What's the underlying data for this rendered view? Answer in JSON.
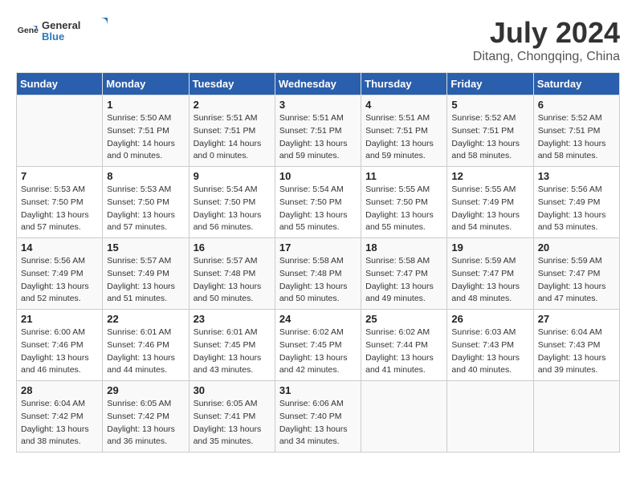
{
  "logo": {
    "general": "General",
    "blue": "Blue"
  },
  "title": "July 2024",
  "subtitle": "Ditang, Chongqing, China",
  "weekdays": [
    "Sunday",
    "Monday",
    "Tuesday",
    "Wednesday",
    "Thursday",
    "Friday",
    "Saturday"
  ],
  "weeks": [
    [
      {
        "day": "",
        "info": ""
      },
      {
        "day": "1",
        "info": "Sunrise: 5:50 AM\nSunset: 7:51 PM\nDaylight: 14 hours\nand 0 minutes."
      },
      {
        "day": "2",
        "info": "Sunrise: 5:51 AM\nSunset: 7:51 PM\nDaylight: 14 hours\nand 0 minutes."
      },
      {
        "day": "3",
        "info": "Sunrise: 5:51 AM\nSunset: 7:51 PM\nDaylight: 13 hours\nand 59 minutes."
      },
      {
        "day": "4",
        "info": "Sunrise: 5:51 AM\nSunset: 7:51 PM\nDaylight: 13 hours\nand 59 minutes."
      },
      {
        "day": "5",
        "info": "Sunrise: 5:52 AM\nSunset: 7:51 PM\nDaylight: 13 hours\nand 58 minutes."
      },
      {
        "day": "6",
        "info": "Sunrise: 5:52 AM\nSunset: 7:51 PM\nDaylight: 13 hours\nand 58 minutes."
      }
    ],
    [
      {
        "day": "7",
        "info": "Sunrise: 5:53 AM\nSunset: 7:50 PM\nDaylight: 13 hours\nand 57 minutes."
      },
      {
        "day": "8",
        "info": "Sunrise: 5:53 AM\nSunset: 7:50 PM\nDaylight: 13 hours\nand 57 minutes."
      },
      {
        "day": "9",
        "info": "Sunrise: 5:54 AM\nSunset: 7:50 PM\nDaylight: 13 hours\nand 56 minutes."
      },
      {
        "day": "10",
        "info": "Sunrise: 5:54 AM\nSunset: 7:50 PM\nDaylight: 13 hours\nand 55 minutes."
      },
      {
        "day": "11",
        "info": "Sunrise: 5:55 AM\nSunset: 7:50 PM\nDaylight: 13 hours\nand 55 minutes."
      },
      {
        "day": "12",
        "info": "Sunrise: 5:55 AM\nSunset: 7:49 PM\nDaylight: 13 hours\nand 54 minutes."
      },
      {
        "day": "13",
        "info": "Sunrise: 5:56 AM\nSunset: 7:49 PM\nDaylight: 13 hours\nand 53 minutes."
      }
    ],
    [
      {
        "day": "14",
        "info": "Sunrise: 5:56 AM\nSunset: 7:49 PM\nDaylight: 13 hours\nand 52 minutes."
      },
      {
        "day": "15",
        "info": "Sunrise: 5:57 AM\nSunset: 7:49 PM\nDaylight: 13 hours\nand 51 minutes."
      },
      {
        "day": "16",
        "info": "Sunrise: 5:57 AM\nSunset: 7:48 PM\nDaylight: 13 hours\nand 50 minutes."
      },
      {
        "day": "17",
        "info": "Sunrise: 5:58 AM\nSunset: 7:48 PM\nDaylight: 13 hours\nand 50 minutes."
      },
      {
        "day": "18",
        "info": "Sunrise: 5:58 AM\nSunset: 7:47 PM\nDaylight: 13 hours\nand 49 minutes."
      },
      {
        "day": "19",
        "info": "Sunrise: 5:59 AM\nSunset: 7:47 PM\nDaylight: 13 hours\nand 48 minutes."
      },
      {
        "day": "20",
        "info": "Sunrise: 5:59 AM\nSunset: 7:47 PM\nDaylight: 13 hours\nand 47 minutes."
      }
    ],
    [
      {
        "day": "21",
        "info": "Sunrise: 6:00 AM\nSunset: 7:46 PM\nDaylight: 13 hours\nand 46 minutes."
      },
      {
        "day": "22",
        "info": "Sunrise: 6:01 AM\nSunset: 7:46 PM\nDaylight: 13 hours\nand 44 minutes."
      },
      {
        "day": "23",
        "info": "Sunrise: 6:01 AM\nSunset: 7:45 PM\nDaylight: 13 hours\nand 43 minutes."
      },
      {
        "day": "24",
        "info": "Sunrise: 6:02 AM\nSunset: 7:45 PM\nDaylight: 13 hours\nand 42 minutes."
      },
      {
        "day": "25",
        "info": "Sunrise: 6:02 AM\nSunset: 7:44 PM\nDaylight: 13 hours\nand 41 minutes."
      },
      {
        "day": "26",
        "info": "Sunrise: 6:03 AM\nSunset: 7:43 PM\nDaylight: 13 hours\nand 40 minutes."
      },
      {
        "day": "27",
        "info": "Sunrise: 6:04 AM\nSunset: 7:43 PM\nDaylight: 13 hours\nand 39 minutes."
      }
    ],
    [
      {
        "day": "28",
        "info": "Sunrise: 6:04 AM\nSunset: 7:42 PM\nDaylight: 13 hours\nand 38 minutes."
      },
      {
        "day": "29",
        "info": "Sunrise: 6:05 AM\nSunset: 7:42 PM\nDaylight: 13 hours\nand 36 minutes."
      },
      {
        "day": "30",
        "info": "Sunrise: 6:05 AM\nSunset: 7:41 PM\nDaylight: 13 hours\nand 35 minutes."
      },
      {
        "day": "31",
        "info": "Sunrise: 6:06 AM\nSunset: 7:40 PM\nDaylight: 13 hours\nand 34 minutes."
      },
      {
        "day": "",
        "info": ""
      },
      {
        "day": "",
        "info": ""
      },
      {
        "day": "",
        "info": ""
      }
    ]
  ]
}
